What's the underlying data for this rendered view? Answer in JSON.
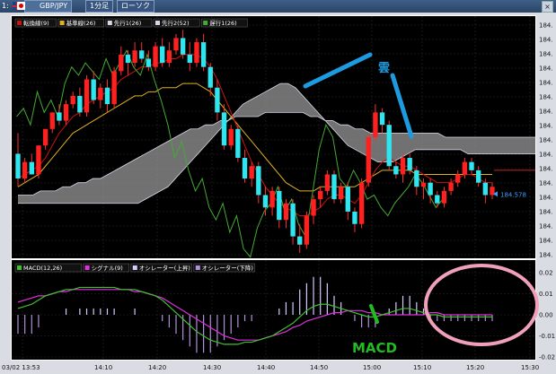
{
  "window": {
    "tab_number": "1:",
    "symbol": "GBP/JPY",
    "timeframe": "1分足",
    "chart_kind": "ローソク",
    "close_glyph": "×"
  },
  "chart_data": [
    {
      "type": "candlestick",
      "indicator_labels": [
        "転換線(9)",
        "基準線(26)",
        "先行1(26)",
        "先行2(52)",
        "遅行1(26)"
      ],
      "indicator_colors": [
        "#cc1111",
        "#e0b020",
        "#d7d7e8",
        "#d7d7e8",
        "#44aa33"
      ],
      "y_axis_prefix": "184.",
      "y_ticks_count": 17,
      "price_labels": [
        "184.578"
      ],
      "x_tick_labels": [
        "03/02 13:53",
        "14:10",
        "14:20",
        "14:30",
        "14:40",
        "14:50",
        "15:00",
        "15:10",
        "15:20",
        "15:30"
      ],
      "candles": [
        [
          0,
          -6,
          5,
          -8,
          7
        ],
        [
          -6,
          -2,
          -1,
          -7,
          -7
        ],
        [
          -2,
          -5,
          0,
          -2,
          -4
        ],
        [
          -5,
          2,
          2,
          -6,
          -1
        ],
        [
          2,
          6,
          6,
          1,
          3
        ],
        [
          6,
          10,
          10,
          5,
          6
        ],
        [
          10,
          8,
          12,
          7,
          8
        ],
        [
          8,
          12,
          13,
          7,
          10
        ],
        [
          12,
          14,
          15,
          11,
          12
        ],
        [
          14,
          10,
          16,
          9,
          14
        ],
        [
          10,
          18,
          19,
          9,
          16
        ],
        [
          18,
          13,
          20,
          12,
          17
        ],
        [
          13,
          16,
          17,
          11,
          18
        ],
        [
          16,
          12,
          18,
          10,
          19
        ],
        [
          12,
          20,
          21,
          11,
          19
        ],
        [
          20,
          24,
          26,
          19,
          20
        ],
        [
          24,
          22,
          25,
          19,
          21
        ],
        [
          22,
          25,
          27,
          21,
          21
        ],
        [
          25,
          23,
          27,
          22,
          22
        ],
        [
          23,
          21,
          25,
          20,
          22
        ],
        [
          21,
          26,
          27,
          20,
          23
        ],
        [
          26,
          22,
          28,
          21,
          24
        ],
        [
          22,
          25,
          27,
          21,
          24
        ],
        [
          25,
          28,
          29,
          24,
          25
        ],
        [
          28,
          24,
          30,
          23,
          25
        ],
        [
          24,
          22,
          27,
          20,
          26
        ],
        [
          22,
          27,
          28,
          21,
          26
        ],
        [
          27,
          21,
          29,
          20,
          24
        ],
        [
          21,
          16,
          22,
          14,
          21
        ],
        [
          16,
          10,
          18,
          8,
          18
        ],
        [
          10,
          2,
          12,
          1,
          14
        ],
        [
          2,
          6,
          7,
          1,
          8
        ],
        [
          6,
          -1,
          7,
          -2,
          3
        ],
        [
          -1,
          -6,
          1,
          -7,
          -1
        ],
        [
          -6,
          -3,
          -2,
          -8,
          -4
        ],
        [
          -3,
          -10,
          -2,
          -12,
          -7
        ],
        [
          -10,
          -13,
          -8,
          -15,
          -10
        ],
        [
          -13,
          -9,
          -8,
          -15,
          -12
        ],
        [
          -9,
          -16,
          -8,
          -18,
          -13
        ],
        [
          -16,
          -12,
          -11,
          -18,
          -14
        ],
        [
          -12,
          -20,
          -11,
          -22,
          -15
        ],
        [
          -20,
          -22,
          -17,
          -24,
          -15
        ],
        [
          -22,
          -15,
          -14,
          -23,
          -14
        ],
        [
          -15,
          -11,
          -10,
          -17,
          -12
        ],
        [
          -11,
          -9,
          -8,
          -13,
          -10
        ],
        [
          -9,
          -5,
          -4,
          -10,
          -8
        ],
        [
          -5,
          -11,
          -4,
          -12,
          -8
        ],
        [
          -11,
          -8,
          -7,
          -12,
          -9
        ],
        [
          -8,
          -14,
          -7,
          -16,
          -11
        ],
        [
          -14,
          -17,
          -13,
          -19,
          -12
        ],
        [
          -17,
          -7,
          -6,
          -18,
          -10
        ],
        [
          -7,
          4,
          5,
          -8,
          -4
        ],
        [
          4,
          10,
          12,
          3,
          -2
        ],
        [
          10,
          7,
          11,
          5,
          0
        ],
        [
          7,
          -3,
          8,
          -4,
          2
        ],
        [
          -3,
          -5,
          -2,
          -6,
          1
        ],
        [
          -5,
          -1,
          0,
          -7,
          0
        ],
        [
          -1,
          -4,
          0,
          -5,
          -1
        ],
        [
          -4,
          -8,
          -3,
          -10,
          -3
        ],
        [
          -8,
          -7,
          -6,
          -11,
          -4
        ],
        [
          -7,
          -10,
          -6,
          -12,
          -5
        ],
        [
          -10,
          -12,
          -9,
          -13,
          -6
        ],
        [
          -12,
          -9,
          -8,
          -13,
          -6
        ],
        [
          -9,
          -7,
          -6,
          -10,
          -6
        ],
        [
          -7,
          -5,
          -4,
          -8,
          -5
        ],
        [
          -5,
          -2,
          -1,
          -6,
          -4
        ],
        [
          -2,
          -4,
          -1,
          -5,
          -3
        ],
        [
          -4,
          -7,
          -3,
          -8,
          -3
        ],
        [
          -7,
          -10,
          -6,
          -12,
          -4
        ],
        [
          -10,
          -8,
          -7,
          -11,
          -5
        ]
      ],
      "ichimoku_lines": {
        "conversion": [
          -6,
          -5,
          -4,
          -3,
          -1,
          2,
          5,
          7,
          9,
          10,
          12,
          13,
          14,
          15,
          16,
          18,
          19,
          20,
          21,
          21,
          22,
          22,
          23,
          23,
          24,
          24,
          24,
          23,
          21,
          18,
          14,
          10,
          6,
          2,
          -2,
          -5,
          -8,
          -10,
          -12,
          -13,
          -14,
          -15,
          -15,
          -14,
          -13,
          -11,
          -10,
          -10,
          -11,
          -12,
          -10,
          -7,
          -4,
          -2,
          -1,
          -2,
          -3,
          -3,
          -4,
          -5,
          -6,
          -7,
          -7,
          -7,
          -6,
          -5,
          -5,
          -6,
          -7,
          -7
        ],
        "base": [
          -8,
          -7,
          -6,
          -5,
          -3,
          -1,
          1,
          3,
          5,
          6,
          7,
          8,
          9,
          10,
          11,
          12,
          13,
          14,
          14,
          15,
          15,
          16,
          16,
          16,
          17,
          17,
          17,
          16,
          15,
          13,
          11,
          9,
          7,
          5,
          3,
          1,
          -1,
          -3,
          -5,
          -7,
          -8,
          -9,
          -9,
          -9,
          -8,
          -8,
          -8,
          -8,
          -8,
          -8,
          -7,
          -6,
          -5,
          -4,
          -4,
          -4,
          -4,
          -4,
          -5,
          -5,
          -5,
          -5,
          -5,
          -5,
          -5,
          -5,
          -5,
          -5,
          -5,
          -5
        ],
        "span_a": [
          -10,
          -10,
          -10,
          -9,
          -9,
          -9,
          -8,
          -8,
          -7,
          -7,
          -6,
          -6,
          -5,
          -4,
          -3,
          -2,
          -1,
          0,
          1,
          2,
          3,
          4,
          5,
          6,
          6,
          7,
          7,
          8,
          8,
          9,
          9,
          9,
          9,
          10,
          10,
          10,
          10,
          10,
          10,
          9,
          9,
          8,
          8,
          7,
          7,
          6,
          6,
          5,
          5,
          5,
          5,
          5,
          5,
          5,
          5,
          5,
          5,
          4,
          4,
          4,
          4,
          4,
          4,
          4,
          4,
          4,
          4,
          4,
          4,
          4
        ],
        "span_b": [
          -12,
          -12,
          -12,
          -12,
          -12,
          -12,
          -12,
          -12,
          -12,
          -12,
          -12,
          -12,
          -12,
          -12,
          -12,
          -12,
          -12,
          -11,
          -10,
          -9,
          -8,
          -6,
          -4,
          -2,
          0,
          2,
          4,
          6,
          8,
          10,
          12,
          13,
          14,
          15,
          16,
          17,
          17,
          16,
          14,
          12,
          10,
          8,
          6,
          4,
          2,
          1,
          0,
          -1,
          -2,
          -2,
          -2,
          -1,
          0,
          1,
          1,
          1,
          1,
          1,
          1,
          1,
          0,
          0,
          0,
          0,
          0,
          0,
          0,
          0,
          0,
          0
        ]
      },
      "macd_labels": [
        "MACD(12,26)",
        "シグナル(9)",
        "オシレーター(上昇)",
        "オシレーター(下降)"
      ],
      "macd_y_ticks": [
        "0.02",
        "0.01",
        "0.00",
        "-0.01",
        "-0.02"
      ],
      "macd": [
        0.003,
        0.004,
        0.005,
        0.007,
        0.009,
        0.01,
        0.011,
        0.012,
        0.012,
        0.013,
        0.013,
        0.013,
        0.013,
        0.013,
        0.013,
        0.012,
        0.012,
        0.012,
        0.011,
        0.01,
        0.009,
        0.007,
        0.004,
        0.001,
        -0.002,
        -0.005,
        -0.008,
        -0.01,
        -0.012,
        -0.013,
        -0.014,
        -0.014,
        -0.014,
        -0.013,
        -0.013,
        -0.012,
        -0.011,
        -0.01,
        -0.008,
        -0.006,
        -0.004,
        -0.001,
        0.002,
        0.004,
        0.005,
        0.005,
        0.004,
        0.003,
        0.002,
        0.001,
        0.0,
        -0.001,
        -0.001,
        0.0,
        0.001,
        0.002,
        0.003,
        0.003,
        0.002,
        0.001,
        0.0,
        0.0,
        -0.001,
        -0.001,
        -0.001,
        -0.001,
        -0.001,
        -0.001,
        -0.001,
        -0.001
      ],
      "signal": [
        0.006,
        0.007,
        0.008,
        0.009,
        0.009,
        0.01,
        0.011,
        0.011,
        0.012,
        0.012,
        0.012,
        0.012,
        0.012,
        0.012,
        0.012,
        0.012,
        0.012,
        0.011,
        0.011,
        0.01,
        0.009,
        0.008,
        0.006,
        0.004,
        0.002,
        0.0,
        -0.002,
        -0.004,
        -0.006,
        -0.008,
        -0.01,
        -0.011,
        -0.012,
        -0.012,
        -0.012,
        -0.012,
        -0.011,
        -0.01,
        -0.009,
        -0.008,
        -0.006,
        -0.005,
        -0.003,
        -0.002,
        -0.001,
        0.0,
        0.001,
        0.001,
        0.002,
        0.002,
        0.002,
        0.001,
        0.001,
        0.0,
        0.0,
        0.0,
        0.0,
        0.0,
        0.0,
        0.0,
        0.001,
        0.001,
        0.0,
        0.0,
        0.0,
        0.0,
        0.0,
        0.0,
        0.0,
        0.0
      ],
      "annotations": [
        "雲",
        "MACD"
      ]
    }
  ]
}
